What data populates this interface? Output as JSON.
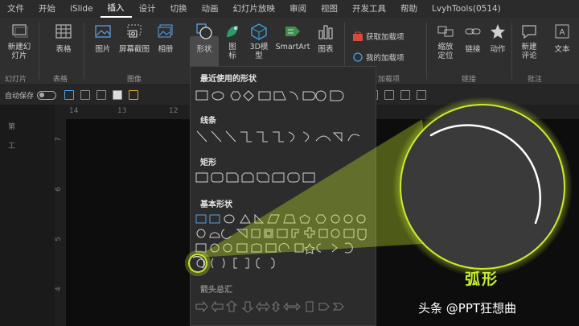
{
  "menubar": {
    "tabs": [
      "文件",
      "开始",
      "iSlide",
      "插入",
      "设计",
      "切换",
      "动画",
      "幻灯片放映",
      "审阅",
      "视图",
      "开发工具",
      "帮助",
      "LvyhTools(0514)"
    ],
    "active_tab": "插入"
  },
  "ribbon": {
    "new_slide": "新建幻灯片",
    "table": "表格",
    "picture": "图片",
    "screenshot": "屏幕截图",
    "album": "相册",
    "shapes": "形状",
    "icons": "图标",
    "model3d": "3D模型",
    "smartart": "SmartArt",
    "chart": "图表",
    "get_addins": "获取加载项",
    "my_addins": "我的加载项",
    "zoom": "缩放定位",
    "link": "链接",
    "action": "动作",
    "new_comment": "新建评论",
    "text": "文本",
    "groups": {
      "slides": "幻灯片",
      "tables": "表格",
      "images": "图像",
      "addins": "加载项",
      "links": "链接",
      "comments": "批注"
    }
  },
  "qat": {
    "autosave_label": "自动保存"
  },
  "left_panel": {
    "items": [
      "第",
      "工"
    ]
  },
  "rulers": {
    "h_ticks": [
      "14",
      "13",
      "12"
    ],
    "v_ticks": [
      "7",
      "6",
      "5",
      "4"
    ]
  },
  "shapes_dropdown": {
    "recent": "最近使用的形状",
    "lines": "线条",
    "rectangles": "矩形",
    "basic": "基本形状",
    "arrows": "箭头总汇"
  },
  "zoom_callout": {
    "label": "弧形",
    "accent_color": "#c9ec2c"
  },
  "watermark": {
    "text": "头条 @PPT狂想曲"
  },
  "colors": {
    "ribbon_bg": "#2f2f2f",
    "menubar_bg": "#2b2b2b",
    "canvas_bg": "#0d0d0d",
    "dropdown_bg": "#2c2c2c",
    "highlight": "#c9ec2c"
  }
}
